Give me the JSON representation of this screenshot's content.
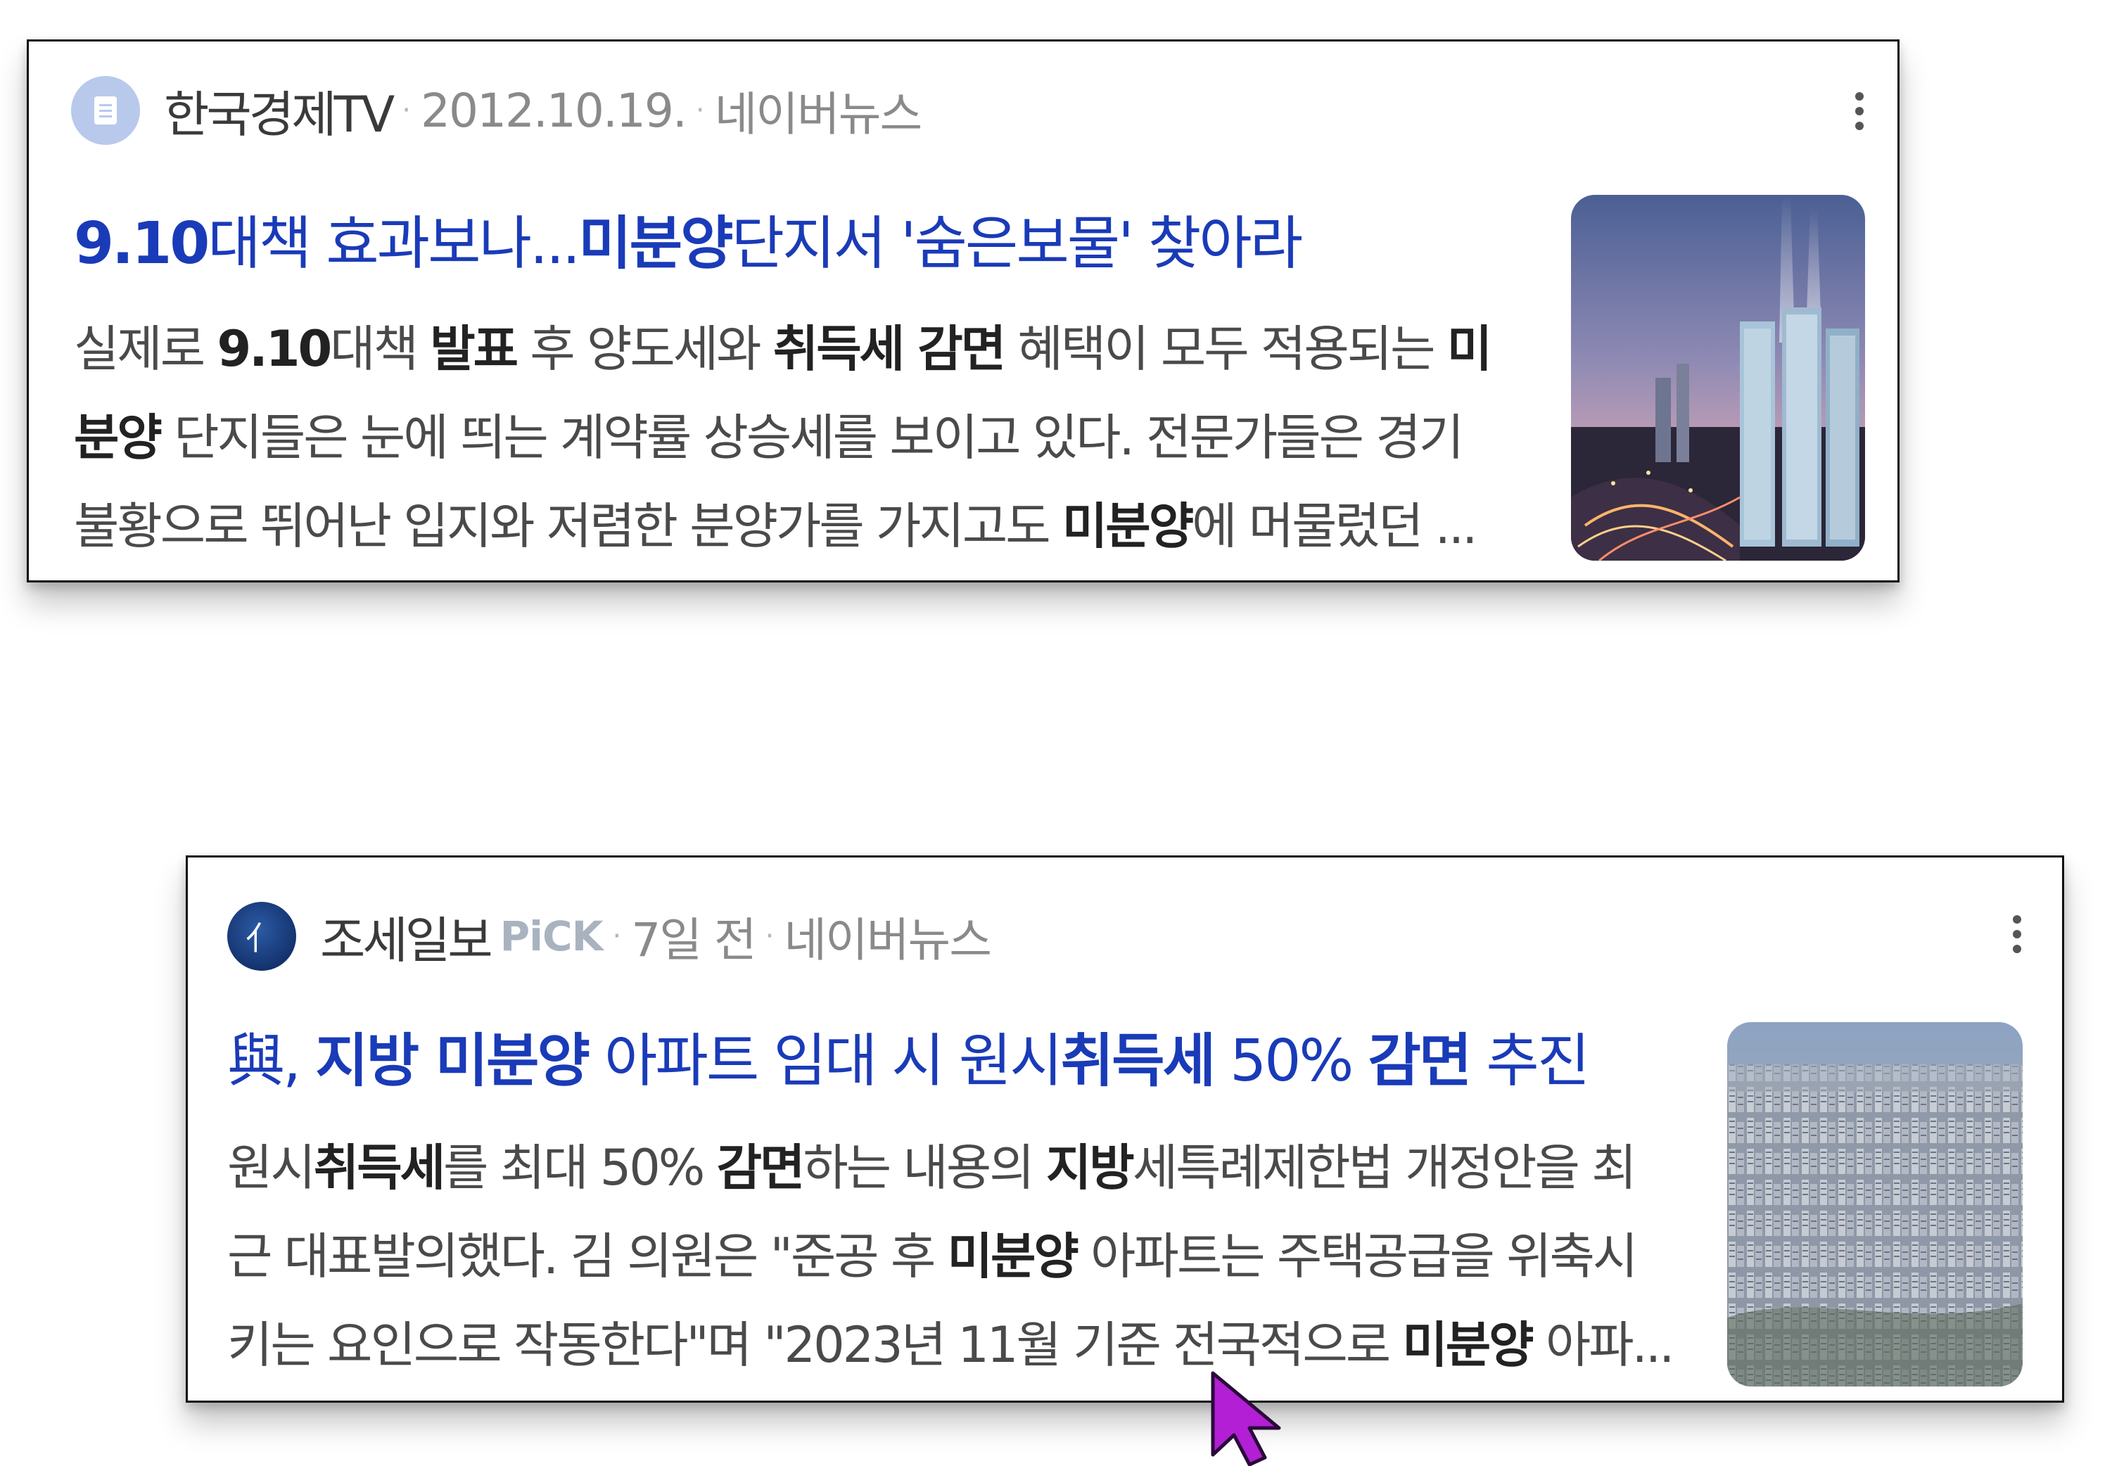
{
  "results": [
    {
      "source_icon": "document-icon",
      "source_name": "한국경제TV",
      "pick_badge": "",
      "date": "2012.10.19.",
      "platform": "네이버뉴스",
      "headline": [
        {
          "text": "9.10",
          "bold": true
        },
        {
          "text": "대책 효과보나...",
          "bold": false
        },
        {
          "text": "미분양",
          "bold": true
        },
        {
          "text": "단지서 '숨은보물' 찾아라",
          "bold": false
        }
      ],
      "snippet_lines": [
        [
          {
            "text": "실제로 ",
            "bold": false
          },
          {
            "text": "9.10",
            "bold": true
          },
          {
            "text": "대책 ",
            "bold": false
          },
          {
            "text": "발표",
            "bold": true
          },
          {
            "text": " 후 양도세와 ",
            "bold": false
          },
          {
            "text": "취득세 감면",
            "bold": true
          },
          {
            "text": " 혜택이 모두 적용되는 ",
            "bold": false
          },
          {
            "text": "미",
            "bold": true
          }
        ],
        [
          {
            "text": "분양",
            "bold": true
          },
          {
            "text": " 단지들은 눈에 띄는 계약률 상승세를 보이고 있다. 전문가들은 경기",
            "bold": false
          }
        ],
        [
          {
            "text": "불황으로 뛰어난 입지와 저렴한 분양가를 가지고도 ",
            "bold": false
          },
          {
            "text": "미분양",
            "bold": true
          },
          {
            "text": "에 머물렀던 ...",
            "bold": false
          }
        ]
      ],
      "thumbnail": "city-night-highrise-thumbnail"
    },
    {
      "source_icon": "joseilbo-logo-icon",
      "source_name": "조세일보",
      "pick_badge": "PiCK",
      "date": "7일 전",
      "platform": "네이버뉴스",
      "headline": [
        {
          "text": "與, ",
          "bold": false
        },
        {
          "text": "지방 미분양",
          "bold": true
        },
        {
          "text": " 아파트 임대 시 원시",
          "bold": false
        },
        {
          "text": "취득세",
          "bold": true
        },
        {
          "text": " 50% ",
          "bold": false
        },
        {
          "text": "감면",
          "bold": true
        },
        {
          "text": " 추진",
          "bold": false
        }
      ],
      "snippet_lines": [
        [
          {
            "text": "원시",
            "bold": false
          },
          {
            "text": "취득세",
            "bold": true
          },
          {
            "text": "를 최대 50% ",
            "bold": false
          },
          {
            "text": "감면",
            "bold": true
          },
          {
            "text": "하는 내용의 ",
            "bold": false
          },
          {
            "text": "지방",
            "bold": true
          },
          {
            "text": "세특례제한법 개정안을 최",
            "bold": false
          }
        ],
        [
          {
            "text": "근 대표발의했다. 김 의원은 \"준공 후 ",
            "bold": false
          },
          {
            "text": "미분양",
            "bold": true
          },
          {
            "text": " 아파트는 주택공급을 위축시",
            "bold": false
          }
        ],
        [
          {
            "text": "키는 요인으로 작동한다\"며 \"2023년 11월 기준 전국적으로 ",
            "bold": false
          },
          {
            "text": "미분양",
            "bold": true
          },
          {
            "text": " 아파...",
            "bold": false
          }
        ]
      ],
      "thumbnail": "city-apartments-aerial-thumbnail"
    }
  ],
  "colors": {
    "headline": "#1a3bb8",
    "snippet": "#4a4a4a",
    "meta": "#8a8a8a",
    "cursor": "#b21fd4"
  }
}
